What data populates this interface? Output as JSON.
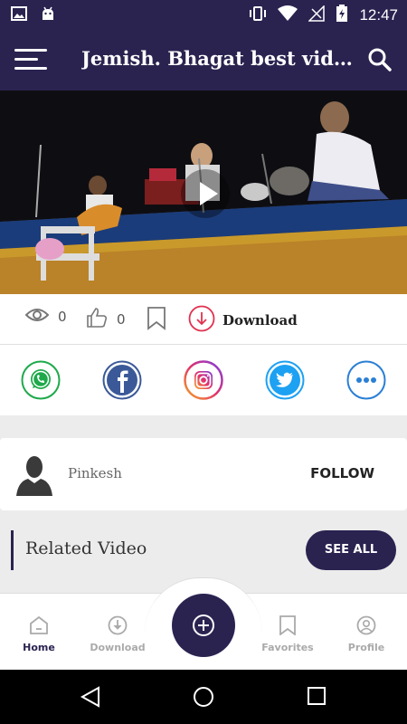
{
  "status": {
    "time": "12:47"
  },
  "header": {
    "title": "Jemish. Bhagat best video..."
  },
  "stats": {
    "views": "0",
    "likes": "0",
    "download_label": "Download"
  },
  "share": {
    "items": [
      "whatsapp-icon",
      "facebook-icon",
      "instagram-icon",
      "twitter-icon",
      "more-icon"
    ]
  },
  "author": {
    "name": "Pinkesh",
    "follow_label": "FOLLOW"
  },
  "related": {
    "title": "Related Video",
    "see_all_label": "SEE ALL"
  },
  "bottom_nav": {
    "items": [
      {
        "label": "Home",
        "icon": "home-icon",
        "active": true
      },
      {
        "label": "Download",
        "icon": "download-icon",
        "active": false
      },
      {
        "label": "Favorites",
        "icon": "bookmark-icon",
        "active": false
      },
      {
        "label": "Profile",
        "icon": "profile-icon",
        "active": false
      }
    ]
  },
  "colors": {
    "primary": "#2a2350",
    "whatsapp": "#1fa94b",
    "facebook": "#3b5998",
    "twitter": "#1da1f2",
    "more": "#2a7fd4",
    "download": "#e0314f"
  }
}
